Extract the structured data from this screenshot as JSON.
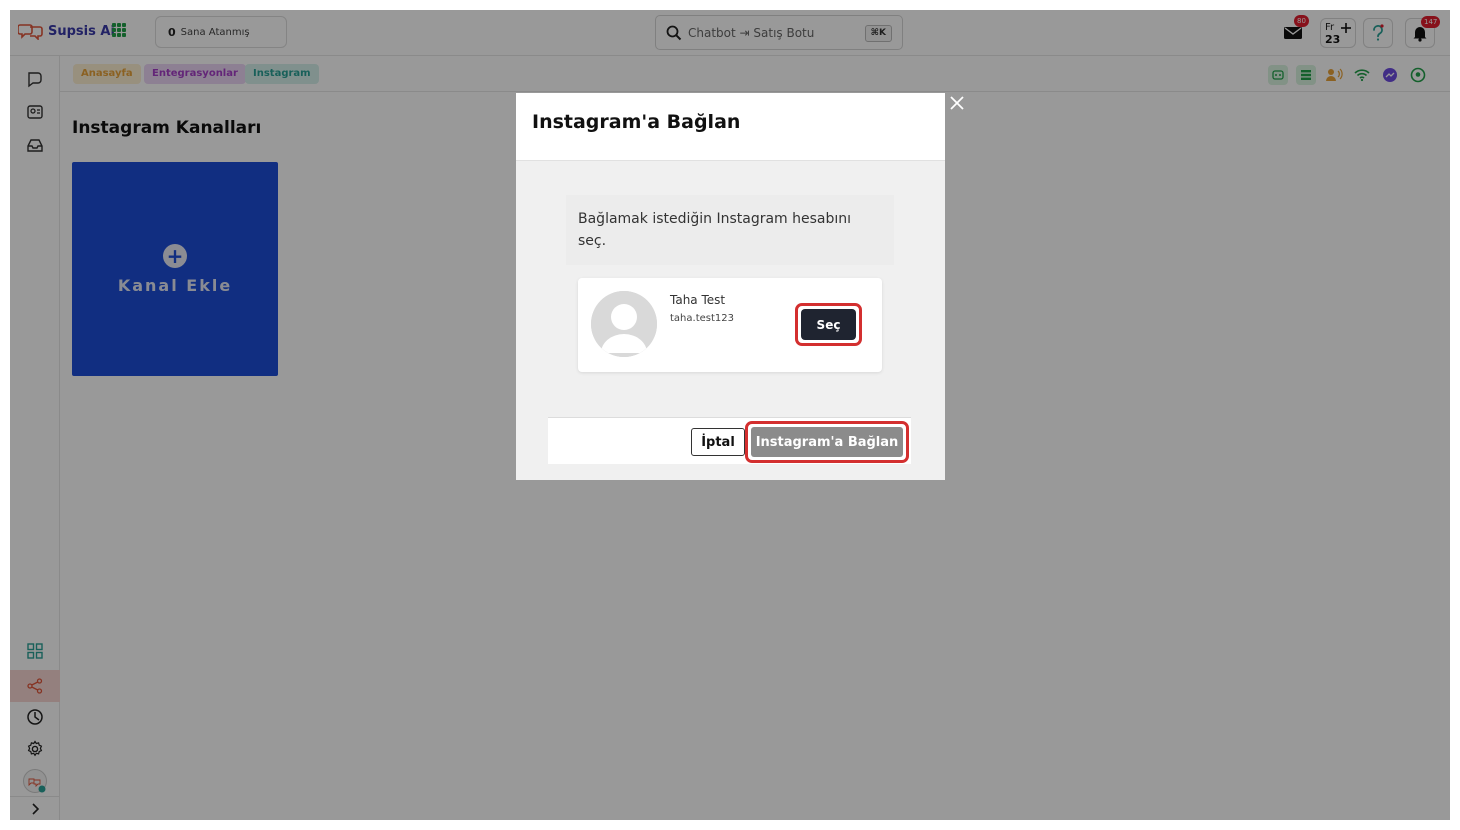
{
  "topbar": {
    "brand": "Supsis Ai",
    "assigned_count": "0",
    "assigned_label": "Sana Atanmış",
    "search_placeholder": "Chatbot ⇥ Satış Botu",
    "search_shortcut": "⌘K",
    "mail_badge": "80",
    "date_day_abbr": "Fr",
    "date_day": "23",
    "notification_badge": "147"
  },
  "breadcrumb": [
    "Anasayfa",
    "Entegrasyonlar",
    "Instagram"
  ],
  "main": {
    "title": "Instagram Kanalları",
    "add_card_label": "Kanal Ekle"
  },
  "modal": {
    "title": "Instagram'a Bağlan",
    "prompt": "Bağlamak istediğin Instagram hesabını seç.",
    "account": {
      "name": "Taha Test",
      "username": "taha.test123",
      "select_label": "Seç"
    },
    "cancel_label": "İptal",
    "connect_label": "Instagram'a Bağlan"
  },
  "colors": {
    "accent_blue": "#1d4ed8",
    "highlight_red": "#d32f2f",
    "active_sidebar": "#f7d6d2"
  }
}
